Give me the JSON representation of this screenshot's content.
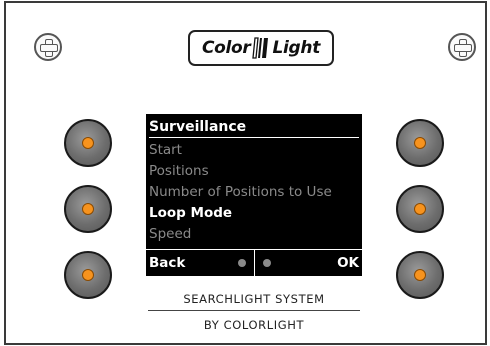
{
  "logo": {
    "left": "Color",
    "right": "Light"
  },
  "screen": {
    "title": "Surveillance",
    "menu": [
      {
        "label": "Start",
        "state": "dimmed"
      },
      {
        "label": "Positions",
        "state": "dimmed"
      },
      {
        "label": "Number of Positions to Use",
        "state": "dimmed"
      },
      {
        "label": "Loop Mode",
        "state": "selected"
      },
      {
        "label": "Speed",
        "state": "dimmed"
      }
    ],
    "softkey_left": "Back",
    "softkey_right": "OK"
  },
  "footer": {
    "line1": "SEARCHLIGHT SYSTEM",
    "line2": "BY COLORLIGHT"
  },
  "colors": {
    "button_indicator": "#f7931e",
    "screen_bg": "#000000",
    "menu_dimmed": "#8a8a8a",
    "menu_selected": "#ffffff"
  }
}
